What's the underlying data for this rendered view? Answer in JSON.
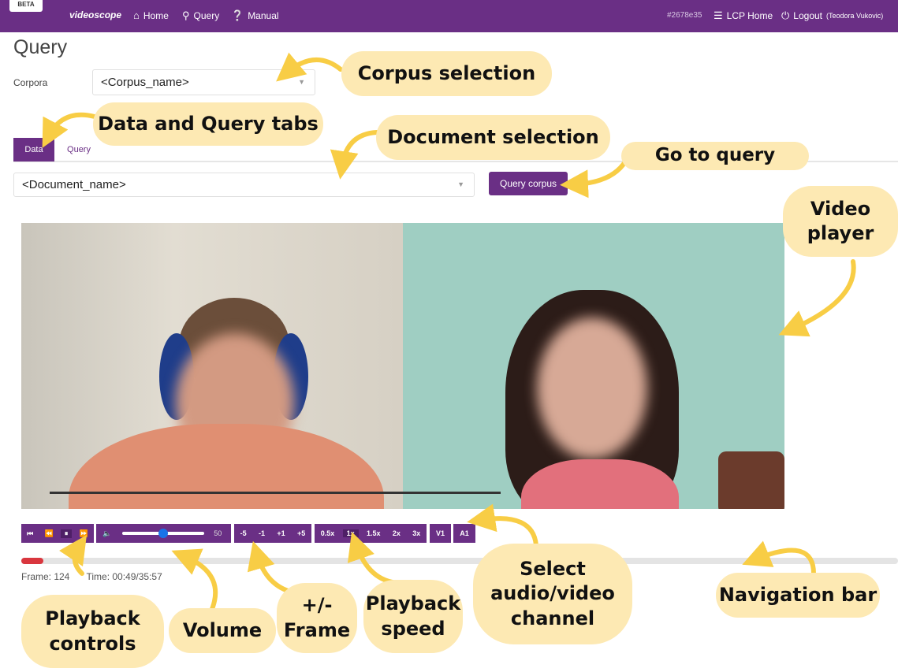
{
  "navbar": {
    "beta": "BETA",
    "brand": "videoscope",
    "home": "Home",
    "query": "Query",
    "manual": "Manual",
    "hash": "#2678e35",
    "lcp_home": "LCP Home",
    "logout": "Logout",
    "user": "(Teodora Vukovic)",
    "color": "#6a2f85"
  },
  "page": {
    "title": "Query",
    "corpora_label": "Corpora",
    "corpus_value": "<Corpus_name>",
    "tabs": [
      "Data",
      "Query"
    ],
    "document_value": "<Document_name>",
    "query_button": "Query corpus"
  },
  "controls": {
    "playback": [
      "⏮",
      "⏪",
      "⏸",
      "⏩"
    ],
    "volume_value": "50",
    "volume_fraction": 0.5,
    "frame_steps": [
      "-5",
      "-1",
      "+1",
      "+5"
    ],
    "speeds": [
      "0.5x",
      "1x",
      "1.5x",
      "2x",
      "3x"
    ],
    "active_speed": "1x",
    "video_channel": "V1",
    "audio_channel": "A1"
  },
  "status": {
    "frame": "Frame: 124",
    "time": "Time: 00:49/35:57",
    "progress_fraction": 0.025
  },
  "callouts": {
    "corpus": "Corpus selection",
    "tabs": "Data and Query tabs",
    "document": "Document selection",
    "goto_query": "Go to query",
    "video_player": "Video player",
    "playback": "Playback controls",
    "volume": "Volume",
    "frame": "+/- Frame",
    "speed": "Playback speed",
    "channel": "Select audio/video channel",
    "navigation": "Navigation bar",
    "color": "#fde9b3",
    "arrow_color": "#f8cd45"
  }
}
